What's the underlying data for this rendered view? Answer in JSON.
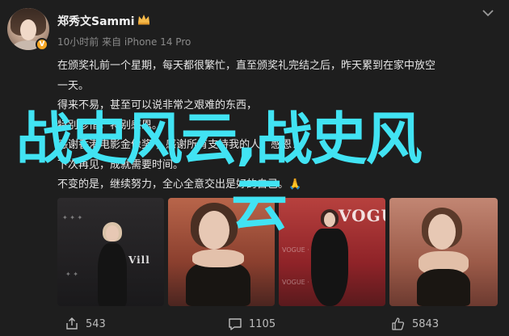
{
  "post": {
    "author": "郑秀文Sammi",
    "verified_badge": "V",
    "meta": "10小时前 来自 iPhone 14 Pro",
    "text_lines": [
      "在颁奖礼前一个星期，每天都很繁忙，直至颁奖礼完结之后，昨天累到在家中放空",
      "一天。",
      "得来不易，甚至可以说非常之艰难的东西，",
      "特别珍惜，特别感恩。",
      "感谢香港电影金像奖 ，感谢所有支持我的人，感恩！",
      "下次再见，成就需要时间。",
      "不变的是，继续努力，全心全意交出是好的自己。🙏"
    ],
    "photos": [
      {
        "alt": "event-photo-1",
        "wall_text": "Vill"
      },
      {
        "alt": "event-photo-2",
        "wall_text": ""
      },
      {
        "alt": "event-photo-3",
        "wall_text": "VOGUE"
      },
      {
        "alt": "event-photo-4",
        "wall_text": ""
      }
    ],
    "actions": {
      "share_count": "543",
      "comment_count": "1105",
      "like_count": "5843"
    }
  },
  "overlay": {
    "line1": "战史风云,战史风",
    "line2": "云",
    "color": "#41e3f3"
  },
  "icons": {
    "crown": "crown-icon",
    "menu": "chevron-down-icon",
    "share": "share-icon",
    "comment": "comment-icon",
    "like": "thumbs-up-icon"
  }
}
